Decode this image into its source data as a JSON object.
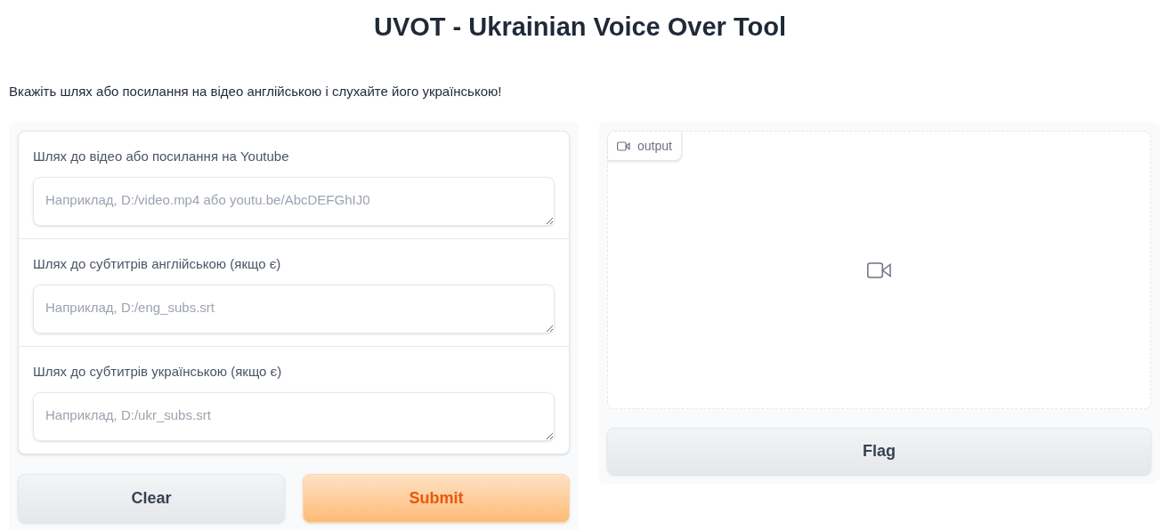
{
  "title": "UVOT - Ukrainian Voice Over Tool",
  "description": "Вкажіть шлях або посилання на відео англійською і слухайте його українською!",
  "inputs": [
    {
      "label": "Шлях до відео або посилання на Youtube",
      "placeholder": "Наприклад, D:/video.mp4 або youtu.be/AbcDEFGhIJ0"
    },
    {
      "label": "Шлях до субтитрів англійською (якщо є)",
      "placeholder": "Наприклад, D:/eng_subs.srt"
    },
    {
      "label": "Шлях до субтитрів українською (якщо є)",
      "placeholder": "Наприклад, D:/ukr_subs.srt"
    }
  ],
  "buttons": [
    {
      "label": "Clear",
      "kind": "secondary"
    },
    {
      "label": "Submit",
      "kind": "primary"
    }
  ],
  "output": {
    "label": "output"
  },
  "flag_button": {
    "label": "Flag"
  }
}
